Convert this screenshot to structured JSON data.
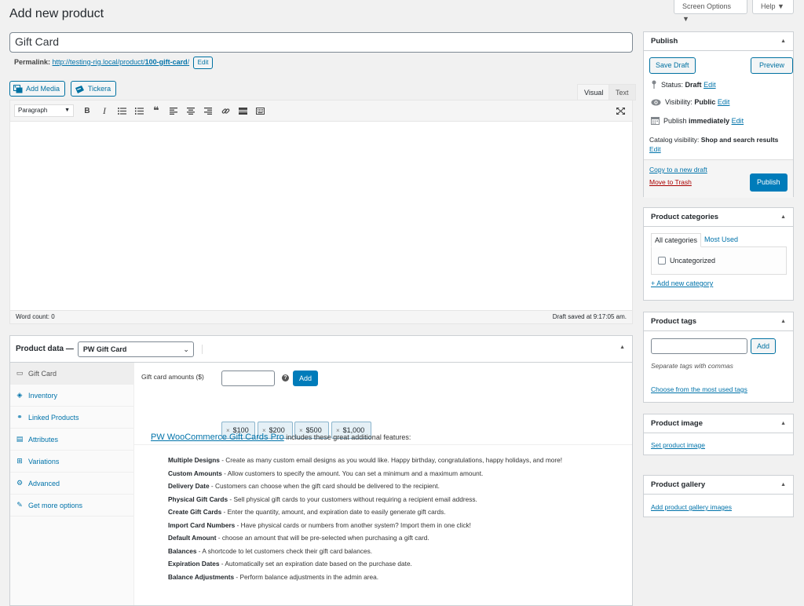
{
  "top": {
    "screen_options": "Screen Options ▼",
    "help": "Help ▼"
  },
  "page_title": "Add new product",
  "title_value": "Gift Card",
  "permalink": {
    "label": "Permalink:",
    "url_prefix": "http://testing-rig.local/product/",
    "slug": "100-gift-card",
    "url_suffix": "/",
    "edit": "Edit"
  },
  "media_buttons": {
    "add_media": "Add Media",
    "tickera": "Tickera"
  },
  "editor": {
    "tabs": {
      "visual": "Visual",
      "text": "Text"
    },
    "format": "Paragraph",
    "word_count": "Word count: 0",
    "draft_saved": "Draft saved at 9:17:05 am."
  },
  "product_data": {
    "label": "Product data —",
    "type": "PW Gift Card",
    "tabs": [
      {
        "label": "Gift Card",
        "icon": "gift-card-icon"
      },
      {
        "label": "Inventory",
        "icon": "inventory-icon"
      },
      {
        "label": "Linked Products",
        "icon": "link-icon"
      },
      {
        "label": "Attributes",
        "icon": "attributes-icon"
      },
      {
        "label": "Variations",
        "icon": "variations-icon"
      },
      {
        "label": "Advanced",
        "icon": "gear-icon"
      },
      {
        "label": "Get more options",
        "icon": "plugin-icon"
      }
    ],
    "amounts_label": "Gift card amounts ($)",
    "amounts_input": "",
    "add_button": "Add",
    "chips": [
      "$100",
      "$200",
      "$500",
      "$1,000"
    ],
    "promo_link": "PW WooCommerce Gift Cards Pro",
    "promo_text": " includes these great additional features:",
    "features": [
      {
        "title": "Multiple Designs",
        "text": " - Create as many custom email designs as you would like. Happy birthday, congratulations, happy holidays, and more!"
      },
      {
        "title": "Custom Amounts",
        "text": " - Allow customers to specify the amount. You can set a minimum and a maximum amount."
      },
      {
        "title": "Delivery Date",
        "text": " - Customers can choose when the gift card should be delivered to the recipient."
      },
      {
        "title": "Physical Gift Cards",
        "text": " - Sell physical gift cards to your customers without requiring a recipient email address."
      },
      {
        "title": "Create Gift Cards",
        "text": " - Enter the quantity, amount, and expiration date to easily generate gift cards."
      },
      {
        "title": "Import Card Numbers",
        "text": " - Have physical cards or numbers from another system? Import them in one click!"
      },
      {
        "title": "Default Amount",
        "text": " - choose an amount that will be pre-selected when purchasing a gift card."
      },
      {
        "title": "Balances",
        "text": " - A shortcode to let customers check their gift card balances."
      },
      {
        "title": "Expiration Dates",
        "text": " - Automatically set an expiration date based on the purchase date."
      },
      {
        "title": "Balance Adjustments",
        "text": " - Perform balance adjustments in the admin area."
      }
    ]
  },
  "publish": {
    "title": "Publish",
    "save_draft": "Save Draft",
    "preview": "Preview",
    "status_label": "Status:",
    "status_value": "Draft",
    "status_edit": "Edit",
    "visibility_label": "Visibility:",
    "visibility_value": "Public",
    "visibility_edit": "Edit",
    "publish_label": "Publish",
    "publish_value": "immediately",
    "publish_edit": "Edit",
    "catalog_label": "Catalog visibility:",
    "catalog_value": "Shop and search results",
    "catalog_edit": "Edit",
    "copy_draft": "Copy to a new draft",
    "trash": "Move to Trash",
    "publish_button": "Publish"
  },
  "categories": {
    "title": "Product categories",
    "tab_all": "All categories",
    "tab_most": "Most Used",
    "items": [
      "Uncategorized"
    ],
    "add_new": "+ Add new category"
  },
  "tags": {
    "title": "Product tags",
    "input": "",
    "add": "Add",
    "hint": "Separate tags with commas",
    "choose": "Choose from the most used tags"
  },
  "image": {
    "title": "Product image",
    "set": "Set product image"
  },
  "gallery": {
    "title": "Product gallery",
    "add": "Add product gallery images"
  }
}
